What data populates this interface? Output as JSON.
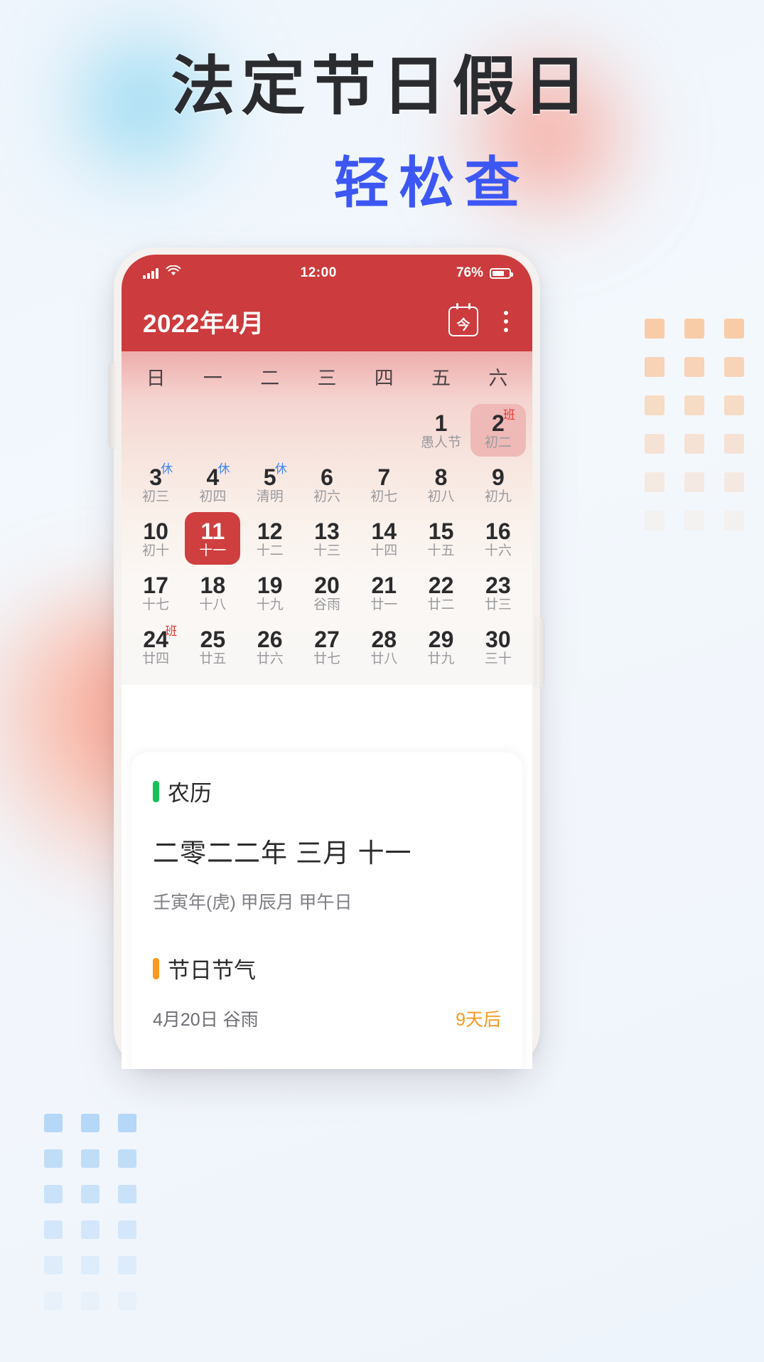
{
  "poster": {
    "headline_line1": "法定节日假日",
    "headline_line2": "轻松查",
    "headline_color": "#2b2c30",
    "accent_blue": "#3d57f5",
    "background_color": "#f2f7fd"
  },
  "phone": {
    "status_bar": {
      "signal_icon": "signal-bars-icon",
      "wifi_icon": "wifi-icon",
      "time": "12:00",
      "battery_percent": "76%",
      "battery_icon": "battery-icon",
      "background_color": "#cc3b3d"
    },
    "app_bar": {
      "title": "2022年4月",
      "today_icon_label": "今",
      "today_icon": "calendar-today-icon",
      "more_icon": "overflow-menu-icon"
    },
    "calendar": {
      "weekdays": [
        "日",
        "一",
        "二",
        "三",
        "四",
        "五",
        "六"
      ],
      "selected_day": "11",
      "rows": [
        [
          {
            "num": "",
            "sub": "",
            "badge": "",
            "state": "empty"
          },
          {
            "num": "",
            "sub": "",
            "badge": "",
            "state": "empty"
          },
          {
            "num": "",
            "sub": "",
            "badge": "",
            "state": "empty"
          },
          {
            "num": "",
            "sub": "",
            "badge": "",
            "state": "empty"
          },
          {
            "num": "",
            "sub": "",
            "badge": "",
            "state": "empty"
          },
          {
            "num": "1",
            "sub": "愚人节",
            "badge": "",
            "state": "normal"
          },
          {
            "num": "2",
            "sub": "初二",
            "badge": "班",
            "badge_color": "#e23b33",
            "state": "soft"
          }
        ],
        [
          {
            "num": "3",
            "sub": "初三",
            "badge": "休",
            "badge_color": "#3d86f5",
            "state": "normal"
          },
          {
            "num": "4",
            "sub": "初四",
            "badge": "休",
            "badge_color": "#3d86f5",
            "state": "normal"
          },
          {
            "num": "5",
            "sub": "清明",
            "badge": "休",
            "badge_color": "#3d86f5",
            "state": "normal"
          },
          {
            "num": "6",
            "sub": "初六",
            "badge": "",
            "state": "normal"
          },
          {
            "num": "7",
            "sub": "初七",
            "badge": "",
            "state": "normal"
          },
          {
            "num": "8",
            "sub": "初八",
            "badge": "",
            "state": "normal"
          },
          {
            "num": "9",
            "sub": "初九",
            "badge": "",
            "state": "normal"
          }
        ],
        [
          {
            "num": "10",
            "sub": "初十",
            "badge": "",
            "state": "normal"
          },
          {
            "num": "11",
            "sub": "十一",
            "badge": "",
            "state": "strong"
          },
          {
            "num": "12",
            "sub": "十二",
            "badge": "",
            "state": "normal"
          },
          {
            "num": "13",
            "sub": "十三",
            "badge": "",
            "state": "normal"
          },
          {
            "num": "14",
            "sub": "十四",
            "badge": "",
            "state": "normal"
          },
          {
            "num": "15",
            "sub": "十五",
            "badge": "",
            "state": "normal"
          },
          {
            "num": "16",
            "sub": "十六",
            "badge": "",
            "state": "normal"
          }
        ],
        [
          {
            "num": "17",
            "sub": "十七",
            "badge": "",
            "state": "normal"
          },
          {
            "num": "18",
            "sub": "十八",
            "badge": "",
            "state": "normal"
          },
          {
            "num": "19",
            "sub": "十九",
            "badge": "",
            "state": "normal"
          },
          {
            "num": "20",
            "sub": "谷雨",
            "badge": "",
            "state": "normal"
          },
          {
            "num": "21",
            "sub": "廿一",
            "badge": "",
            "state": "normal"
          },
          {
            "num": "22",
            "sub": "廿二",
            "badge": "",
            "state": "normal"
          },
          {
            "num": "23",
            "sub": "廿三",
            "badge": "",
            "state": "normal"
          }
        ],
        [
          {
            "num": "24",
            "sub": "廿四",
            "badge": "班",
            "badge_color": "#e23b33",
            "state": "normal"
          },
          {
            "num": "25",
            "sub": "廿五",
            "badge": "",
            "state": "normal"
          },
          {
            "num": "26",
            "sub": "廿六",
            "badge": "",
            "state": "normal"
          },
          {
            "num": "27",
            "sub": "廿七",
            "badge": "",
            "state": "normal"
          },
          {
            "num": "28",
            "sub": "廿八",
            "badge": "",
            "state": "normal"
          },
          {
            "num": "29",
            "sub": "廿九",
            "badge": "",
            "state": "normal"
          },
          {
            "num": "30",
            "sub": "三十",
            "badge": "",
            "state": "normal"
          }
        ]
      ]
    },
    "detail_card": {
      "lunar": {
        "section_title": "农历",
        "accent_color": "#18c157",
        "main": "二零二二年 三月 十一",
        "sub": "壬寅年(虎) 甲辰月 甲午日"
      },
      "festival": {
        "section_title": "节日节气",
        "accent_color": "#f79a1e",
        "items": [
          {
            "name": "4月20日 谷雨",
            "when": "9天后",
            "when_color": "#f79a1e"
          }
        ]
      }
    }
  }
}
